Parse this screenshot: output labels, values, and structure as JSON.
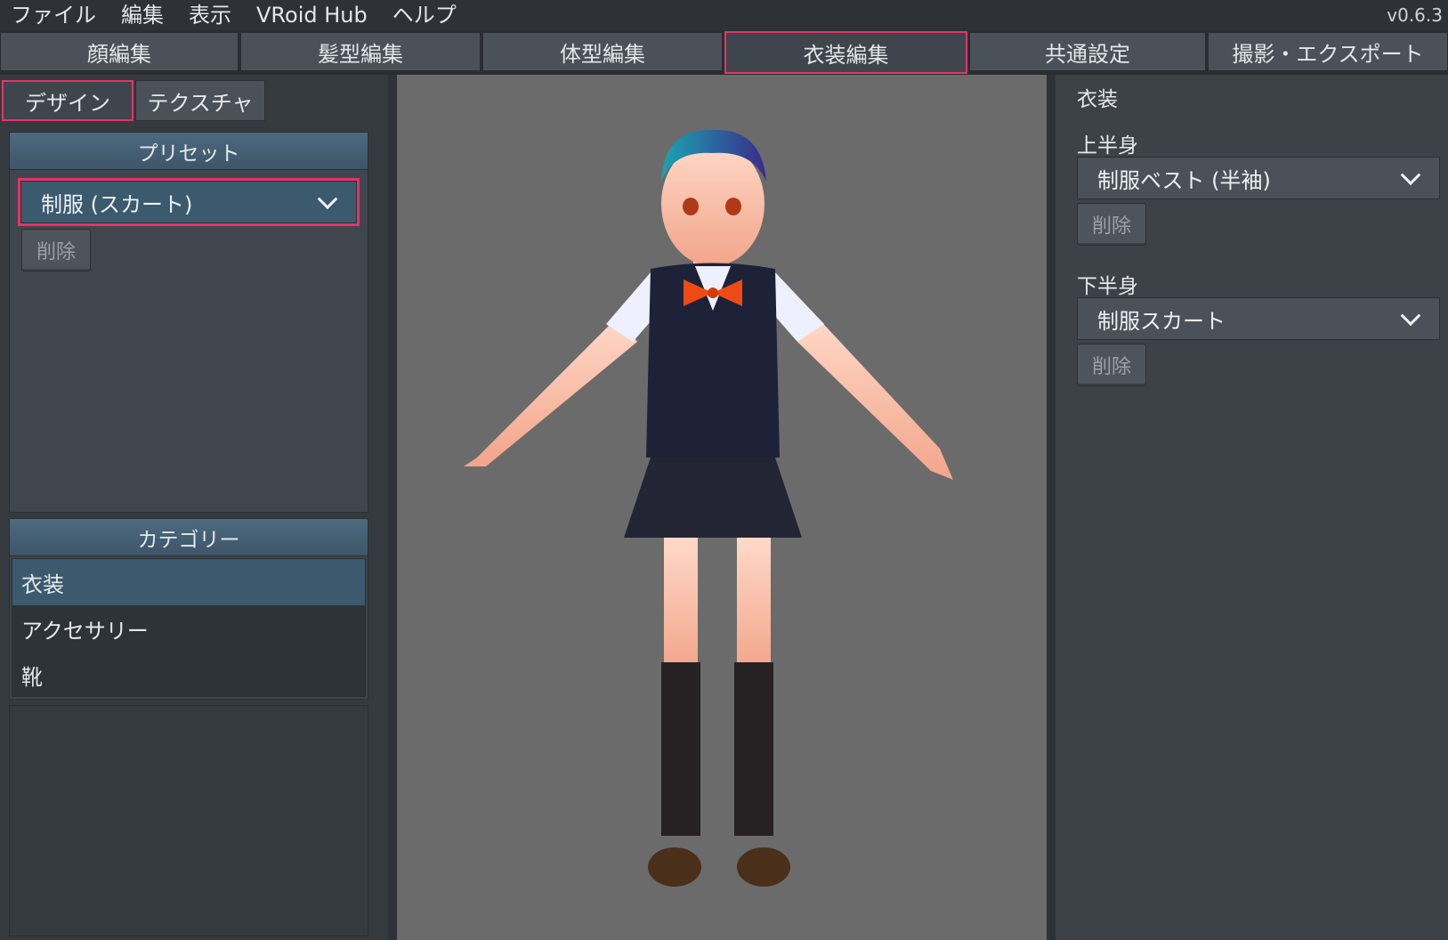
{
  "menu": {
    "items": [
      "ファイル",
      "編集",
      "表示",
      "VRoid Hub",
      "ヘルプ"
    ],
    "version": "v0.6.3"
  },
  "tabs": [
    {
      "label": "顔編集",
      "active": false
    },
    {
      "label": "髪型編集",
      "active": false
    },
    {
      "label": "体型編集",
      "active": false
    },
    {
      "label": "衣装編集",
      "active": true
    },
    {
      "label": "共通設定",
      "active": false
    },
    {
      "label": "撮影・エクスポート",
      "active": false
    }
  ],
  "left_panel": {
    "subtabs": [
      {
        "label": "デザイン",
        "active": true
      },
      {
        "label": "テクスチャ",
        "active": false
      }
    ],
    "preset": {
      "header": "プリセット",
      "selected": "制服 (スカート)",
      "delete_label": "削除"
    },
    "category": {
      "header": "カテゴリー",
      "items": [
        {
          "label": "衣装",
          "active": true
        },
        {
          "label": "アクセサリー",
          "active": false
        },
        {
          "label": "靴",
          "active": false
        }
      ]
    }
  },
  "right_panel": {
    "title": "衣装",
    "upper": {
      "label": "上半身",
      "selected": "制服ベスト (半袖)",
      "delete_label": "削除"
    },
    "lower": {
      "label": "下半身",
      "selected": "制服スカート",
      "delete_label": "削除"
    }
  },
  "colors": {
    "accent_outline": "#e6336b",
    "selected_blue": "#3c5a6e",
    "viewport_bg": "#6b6b6b"
  }
}
